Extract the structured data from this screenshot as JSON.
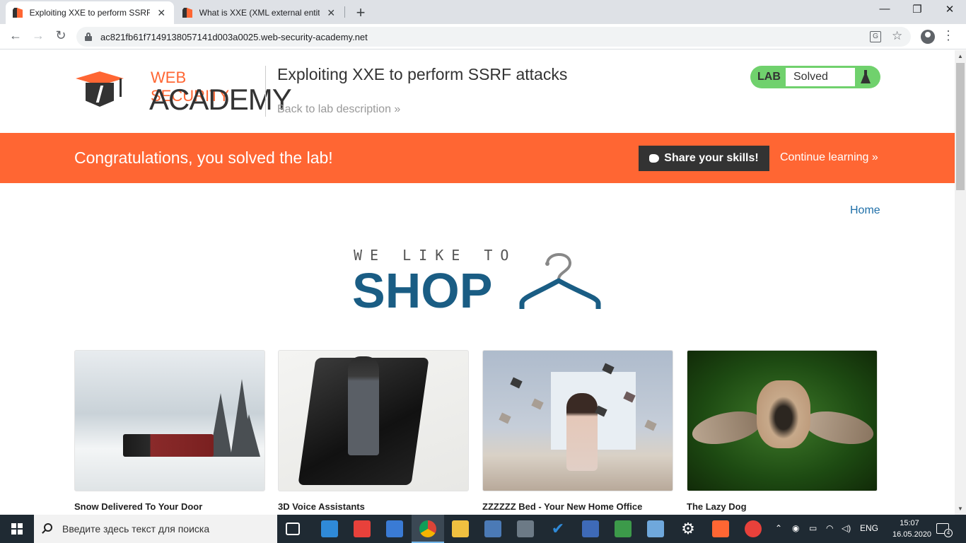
{
  "browser": {
    "tabs": [
      {
        "title": "Exploiting XXE to perform SSRF a",
        "active": true
      },
      {
        "title": "What is XXE (XML external entity)",
        "active": false
      }
    ],
    "new_tab": "+",
    "close_glyph": "✕",
    "window_controls": {
      "minimize": "—",
      "maximize": "❐",
      "close": "✕"
    },
    "url": "ac821fb61f7149138057141d003a0025.web-security-academy.net",
    "nav": {
      "back": "←",
      "forward": "→",
      "reload": "↻"
    },
    "star": "☆",
    "translate": "G",
    "menu": "⋮"
  },
  "header": {
    "logo_line1": "WEB SECURITY",
    "logo_line2": "ACADEMY",
    "lab_title": "Exploiting XXE to perform SSRF attacks",
    "back_link": "Back to lab description »",
    "status_label": "LAB",
    "status_value": "Solved"
  },
  "banner": {
    "message": "Congratulations, you solved the lab!",
    "share_button": "Share your skills!",
    "continue_link": "Continue learning »"
  },
  "nav": {
    "home": "Home"
  },
  "shop_logo": {
    "line1": "WE LIKE TO",
    "line2": "SHOP"
  },
  "products": [
    {
      "name": "Snow Delivered To Your Door"
    },
    {
      "name": "3D Voice Assistants"
    },
    {
      "name": "ZZZZZZ Bed - Your New Home Office"
    },
    {
      "name": "The Lazy Dog"
    }
  ],
  "taskbar": {
    "search_placeholder": "Введите здесь текст для поиска",
    "language": "ENG",
    "time": "15:07",
    "date": "16.05.2020",
    "notification_count": "4"
  },
  "colors": {
    "accent": "#ff6633",
    "link": "#1f6fa8",
    "shop_blue": "#1a5d84",
    "solved_green": "#70d16d"
  }
}
